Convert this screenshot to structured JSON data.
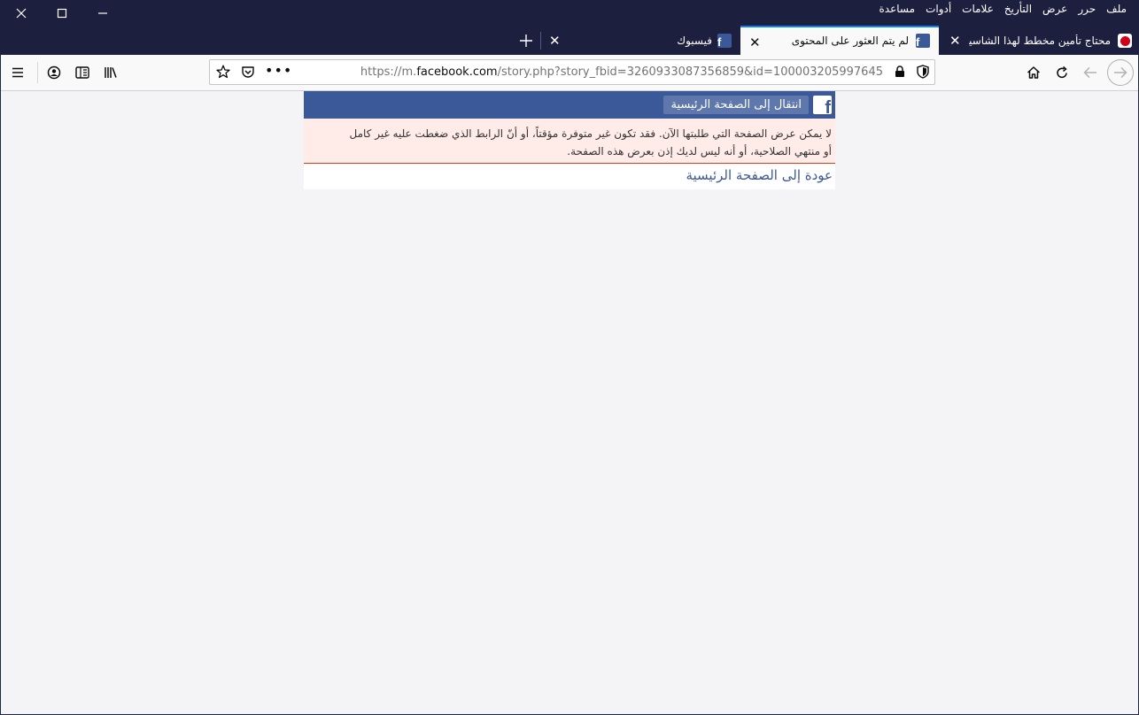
{
  "window": {
    "menu": [
      "ملف",
      "حرر",
      "عرض",
      "التأريخ",
      "علامات",
      "أدوات",
      "مساعدة"
    ]
  },
  "tabs": [
    {
      "title": "محتاج تأمين مخطط لهذا الشاسيه",
      "favicon": "red-badge-icon"
    },
    {
      "title": "لم يتم العثور على المحتوى",
      "favicon": "facebook-icon",
      "active": true
    },
    {
      "title": "فيسبوك",
      "favicon": "facebook-icon"
    }
  ],
  "navbar": {
    "url_prefix": "https://m.",
    "url_domain": "facebook.com",
    "url_path": "/story.php?story_fbid=3260933087356859&id=100003205997645"
  },
  "page": {
    "logo_letter": "f",
    "home_button": "انتقال إلى الصفحة الرئيسية",
    "error_line1": "لا يمكن عرض الصفحة التي طلبتها الآن. فقد تكون غير متوفرة مؤقتاً، أو أنّ الرابط الذي ضغطت عليه غير كامل",
    "error_line2": "أو منتهي الصلاحية، أو أنه ليس لديك إذن بعرض هذه الصفحة.",
    "back_link": "عودة إلى الصفحة الرئيسية"
  },
  "colors": {
    "facebook_blue": "#3b5998",
    "error_bg": "#ffebe8",
    "titlebar": "#1c1f3e"
  }
}
